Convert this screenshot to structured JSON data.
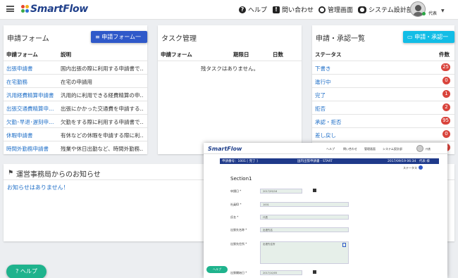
{
  "header": {
    "app_name": "SmartFlow",
    "nav": [
      {
        "label": "ヘルプ",
        "icon": "help-circle-icon"
      },
      {
        "label": "問い合わせ",
        "icon": "inquiry-icon"
      },
      {
        "label": "管理画面",
        "icon": "admin-user-icon"
      },
      {
        "label": "システム設計部",
        "icon": "group-icon"
      }
    ],
    "user_name": "代表"
  },
  "form_card": {
    "title": "申請フォーム",
    "list_button": "申請フォーム一覧",
    "col_form": "申請フォーム",
    "col_desc": "説明",
    "rows": [
      {
        "name": "出張申請書",
        "desc": "国内出張の際に利用する申請書で…"
      },
      {
        "name": "在宅勤務",
        "desc": "在宅の申請用"
      },
      {
        "name": "汎用経費精算申請書",
        "desc": "汎用的に利用できる経費精算の申…"
      },
      {
        "name": "出張交通費精算申…",
        "desc": "出張にかかった交通費を申請する…"
      },
      {
        "name": "欠勤･早退･遅刻申…",
        "desc": "欠勤をする際に利用する申請書で…"
      },
      {
        "name": "休暇申請書",
        "desc": "有休などの休暇を申請する際に利…"
      },
      {
        "name": "時間外勤務申請書",
        "desc": "残業や休日出勤など、時間外勤務…"
      }
    ]
  },
  "task_card": {
    "title": "タスク管理",
    "col_form": "申請フォーム",
    "col_due": "期限日",
    "col_days": "日数",
    "empty": "残タスクはありません。"
  },
  "approval_card": {
    "title": "申請・承認一覧",
    "list_button": "申請・承認一覧",
    "col_status": "ステータス",
    "col_count": "件数",
    "rows": [
      {
        "status": "下書き",
        "count": "25"
      },
      {
        "status": "進行中",
        "count": "0"
      },
      {
        "status": "完了",
        "count": "1"
      },
      {
        "status": "拒否",
        "count": "2"
      },
      {
        "status": "承認・拒否",
        "count": "95"
      },
      {
        "status": "差し戻し",
        "count": "0"
      },
      {
        "status": "",
        "count": "0"
      }
    ]
  },
  "notice_card": {
    "title": "運営事務局からのお知らせ",
    "empty": "お知らせはありません！"
  },
  "help_button": "ヘルプ",
  "overlay": {
    "app_name": "SmartFlow",
    "bar_left": "申請番号：1001 [ 完了 ]",
    "bar_center": "国内出張申請書 - START",
    "bar_right": "2017/09/19 06:34　代表 様",
    "status_link": "ステータス",
    "section": "Section1",
    "fields": [
      {
        "label": "申請日 *",
        "value": "2017/09/16"
      },
      {
        "label": "社員ID *",
        "value": "1001"
      },
      {
        "label": "氏名 *",
        "value": "代表"
      },
      {
        "label": "出張先名称 *",
        "value": "出張先名"
      },
      {
        "label": "出張先住所 *",
        "value": "出張先住所"
      },
      {
        "label": "出張開始日 *",
        "value": "2017/10/05"
      }
    ],
    "help_label": "ヘルプ"
  },
  "colors": {
    "primary": "#2f59c9",
    "accent": "#12bde6",
    "badge": "#d9443c",
    "help": "#1fb38d",
    "link": "#2170c8"
  }
}
